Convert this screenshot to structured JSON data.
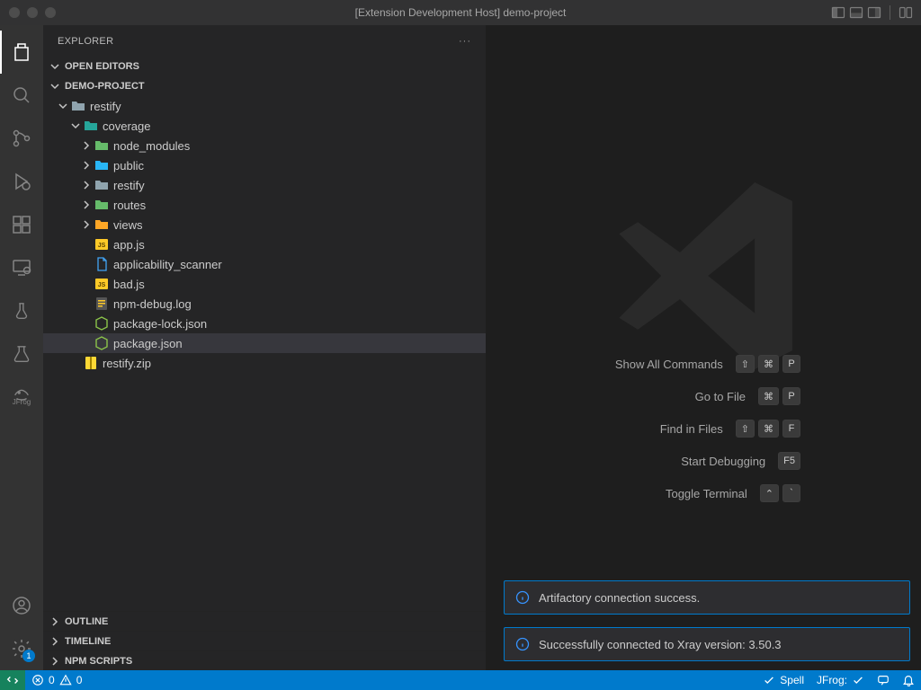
{
  "titlebar": {
    "title": "[Extension Development Host] demo-project"
  },
  "sidebar": {
    "title": "EXPLORER",
    "sections": {
      "openEditors": "OPEN EDITORS",
      "project": "DEMO-PROJECT",
      "outline": "OUTLINE",
      "timeline": "TIMELINE",
      "npmScripts": "NPM SCRIPTS"
    }
  },
  "tree": {
    "restify": "restify",
    "coverage": "coverage",
    "node_modules": "node_modules",
    "public": "public",
    "restify_dir": "restify",
    "routes": "routes",
    "views": "views",
    "app_js": "app.js",
    "applicability_scanner": "applicability_scanner",
    "bad_js": "bad.js",
    "npm_debug_log": "npm-debug.log",
    "package_lock": "package-lock.json",
    "package_json": "package.json",
    "restify_zip": "restify.zip"
  },
  "welcome": {
    "showAll": "Show All Commands",
    "showAllKeys": [
      "⇧",
      "⌘",
      "P"
    ],
    "goToFile": "Go to File",
    "goToFileKeys": [
      "⌘",
      "P"
    ],
    "findInFiles": "Find in Files",
    "findInFilesKeys": [
      "⇧",
      "⌘",
      "F"
    ],
    "startDebug": "Start Debugging",
    "startDebugKeys": [
      "F5"
    ],
    "toggleTerminal": "Toggle Terminal",
    "toggleTerminalKeys": [
      "⌃",
      "`"
    ]
  },
  "toasts": {
    "t1": "Artifactory connection success.",
    "t2": "Successfully connected to Xray version: 3.50.3"
  },
  "statusbar": {
    "errors": "0",
    "warnings": "0",
    "spell": "Spell",
    "jfrog": "JFrog:",
    "settingsBadge": "1"
  }
}
